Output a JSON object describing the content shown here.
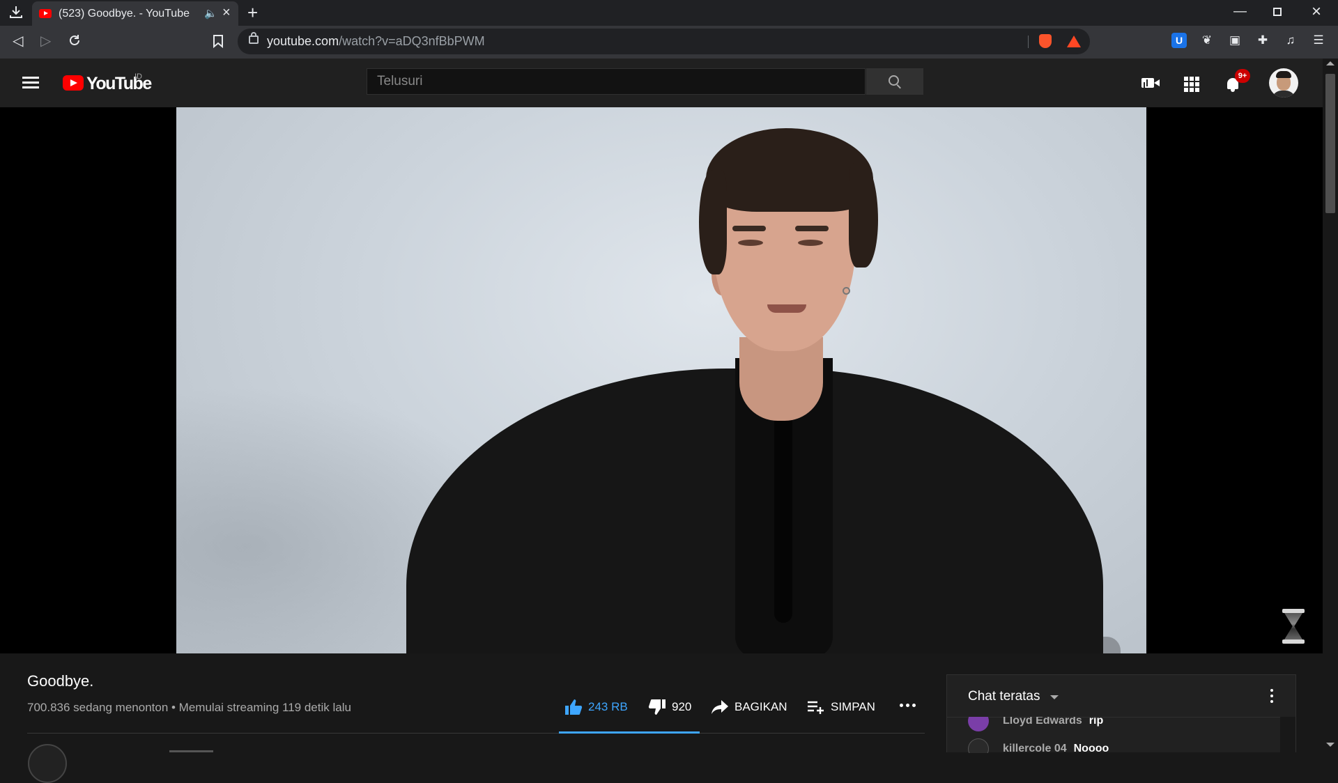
{
  "browser": {
    "tab_title": "(523) Goodbye. - YouTube",
    "url_host": "youtube.com",
    "url_path": "/watch?v=aDQ3nfBbPWM"
  },
  "header": {
    "logo_text": "YouTube",
    "region": "ID",
    "search_placeholder": "Telusuri",
    "notification_badge": "9+"
  },
  "video": {
    "title": "Goodbye.",
    "meta": "700.836 sedang menonton • Memulai streaming 119 detik lalu",
    "like_count": "243 RB",
    "dislike_count": "920",
    "share_label": "BAGIKAN",
    "save_label": "SIMPAN"
  },
  "chat": {
    "title": "Chat teratas",
    "messages": [
      {
        "author": "Lloyd Edwards",
        "text": "rip"
      },
      {
        "author": "killercole 04",
        "text": "Noooo"
      }
    ]
  },
  "colors": {
    "accent": "#3ea6ff",
    "brand": "#ff0000",
    "badge": "#cc0000"
  }
}
